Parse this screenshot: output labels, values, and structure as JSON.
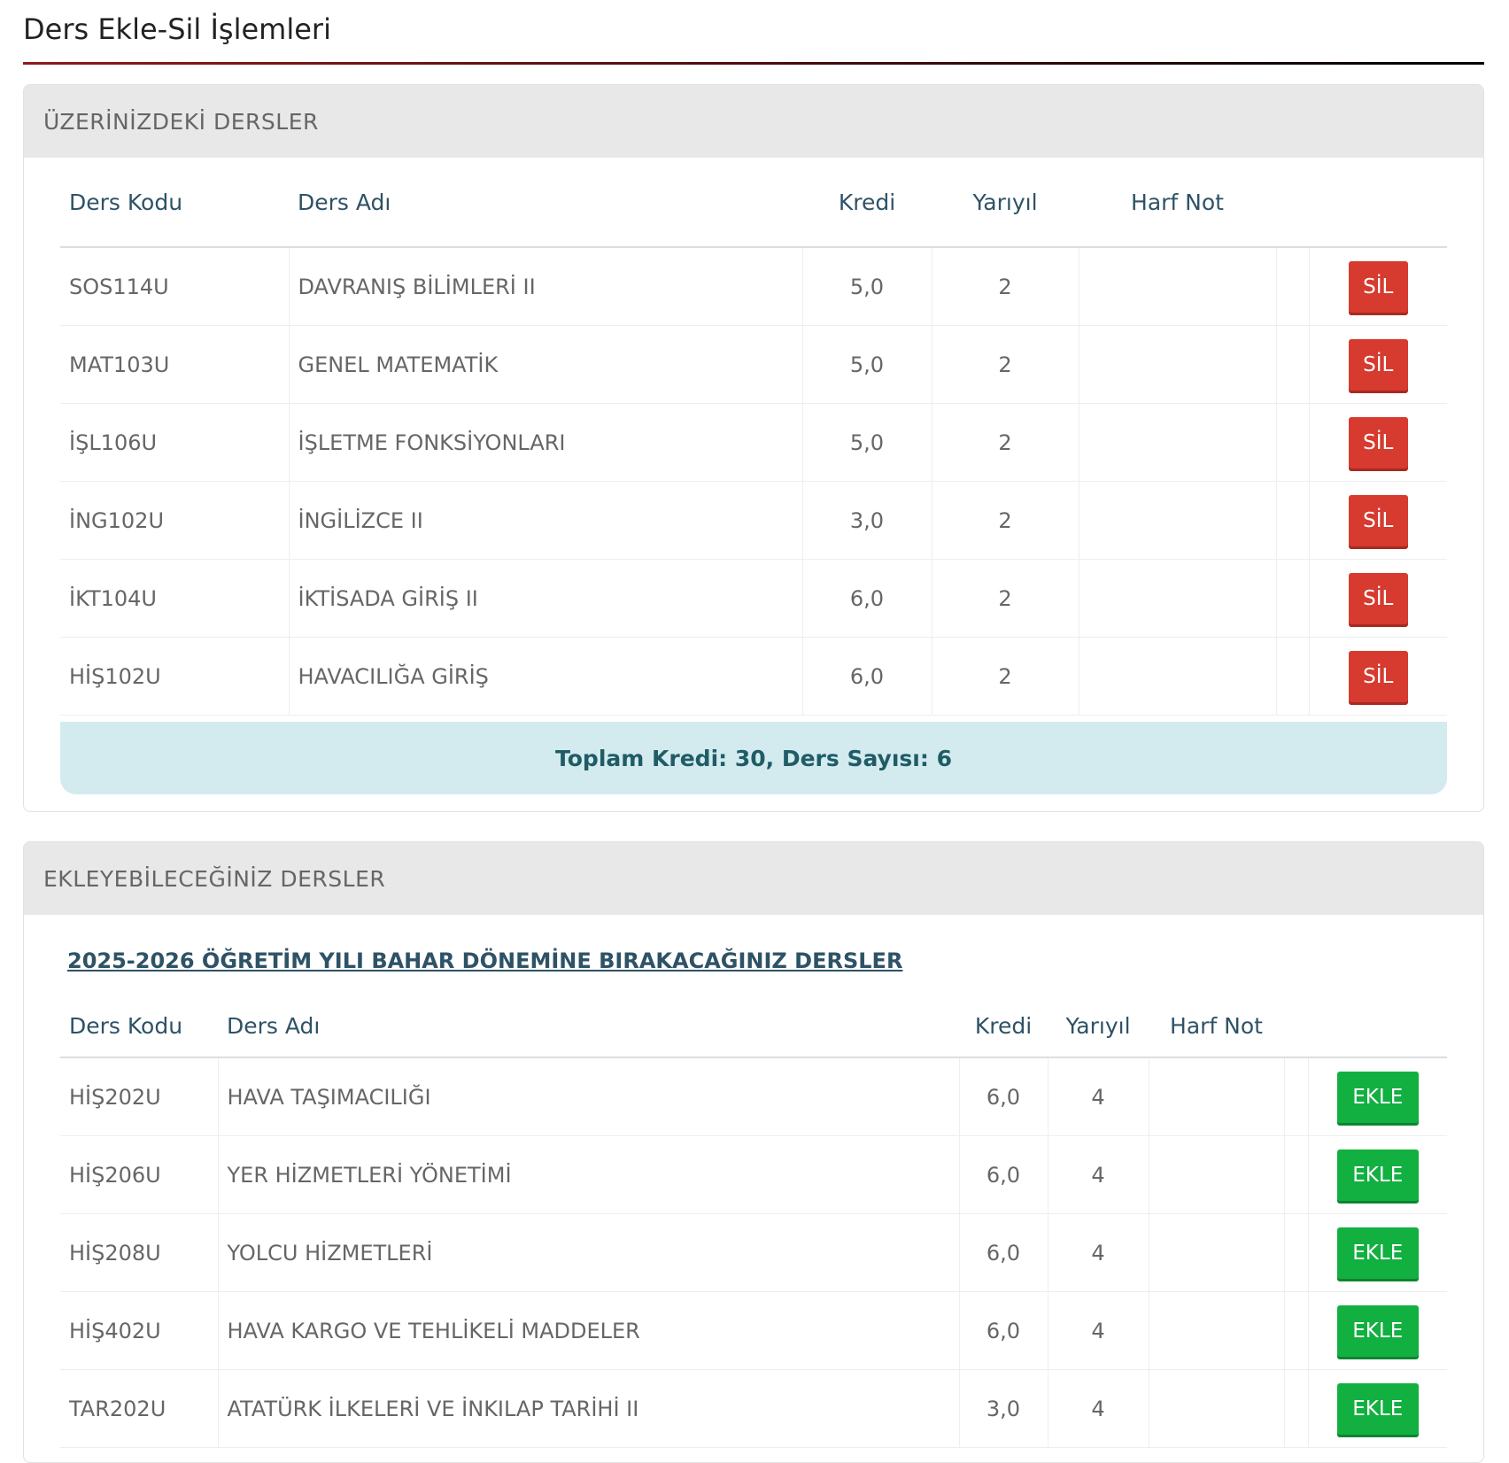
{
  "page_title": "Ders Ekle-Sil İşlemleri",
  "enrolled": {
    "header": "ÜZERİNİZDEKİ DERSLER",
    "columns": {
      "code": "Ders Kodu",
      "name": "Ders Adı",
      "credit": "Kredi",
      "semester": "Yarıyıl",
      "grade": "Harf Not"
    },
    "rows": [
      {
        "code": "SOS114U",
        "name": "DAVRANIŞ BİLİMLERİ II",
        "credit": "5,0",
        "semester": "2",
        "grade": "",
        "action": "SİL"
      },
      {
        "code": "MAT103U",
        "name": "GENEL MATEMATİK",
        "credit": "5,0",
        "semester": "2",
        "grade": "",
        "action": "SİL"
      },
      {
        "code": "İŞL106U",
        "name": "İŞLETME FONKSİYONLARI",
        "credit": "5,0",
        "semester": "2",
        "grade": "",
        "action": "SİL"
      },
      {
        "code": "İNG102U",
        "name": "İNGİLİZCE II",
        "credit": "3,0",
        "semester": "2",
        "grade": "",
        "action": "SİL"
      },
      {
        "code": "İKT104U",
        "name": "İKTİSADA GİRİŞ II",
        "credit": "6,0",
        "semester": "2",
        "grade": "",
        "action": "SİL"
      },
      {
        "code": "HİŞ102U",
        "name": "HAVACILIĞA GİRİŞ",
        "credit": "6,0",
        "semester": "2",
        "grade": "",
        "action": "SİL"
      }
    ],
    "total": "Toplam Kredi: 30, Ders Sayısı: 6"
  },
  "available": {
    "header": "EKLEYEBİLECEĞİNİZ DERSLER",
    "term_link": "2025-2026 ÖĞRETİM YILI BAHAR DÖNEMİNE BIRAKACAĞINIZ DERSLER",
    "columns": {
      "code": "Ders Kodu",
      "name": "Ders Adı",
      "credit": "Kredi",
      "semester": "Yarıyıl",
      "grade": "Harf Not"
    },
    "rows": [
      {
        "code": "HİŞ202U",
        "name": "HAVA TAŞIMACILIĞI",
        "credit": "6,0",
        "semester": "4",
        "grade": "",
        "action": "EKLE"
      },
      {
        "code": "HİŞ206U",
        "name": "YER HİZMETLERİ YÖNETİMİ",
        "credit": "6,0",
        "semester": "4",
        "grade": "",
        "action": "EKLE"
      },
      {
        "code": "HİŞ208U",
        "name": "YOLCU HİZMETLERİ",
        "credit": "6,0",
        "semester": "4",
        "grade": "",
        "action": "EKLE"
      },
      {
        "code": "HİŞ402U",
        "name": "HAVA KARGO VE TEHLİKELİ MADDELER",
        "credit": "6,0",
        "semester": "4",
        "grade": "",
        "action": "EKLE"
      },
      {
        "code": "TAR202U",
        "name": "ATATÜRK İLKELERİ VE İNKILAP TARİHİ II",
        "credit": "3,0",
        "semester": "4",
        "grade": "",
        "action": "EKLE"
      }
    ]
  },
  "colors": {
    "delete_button": "#d73a2e",
    "add_button": "#12b040",
    "title_rule": "#8e1b1b",
    "total_bg": "#d3ebef"
  }
}
